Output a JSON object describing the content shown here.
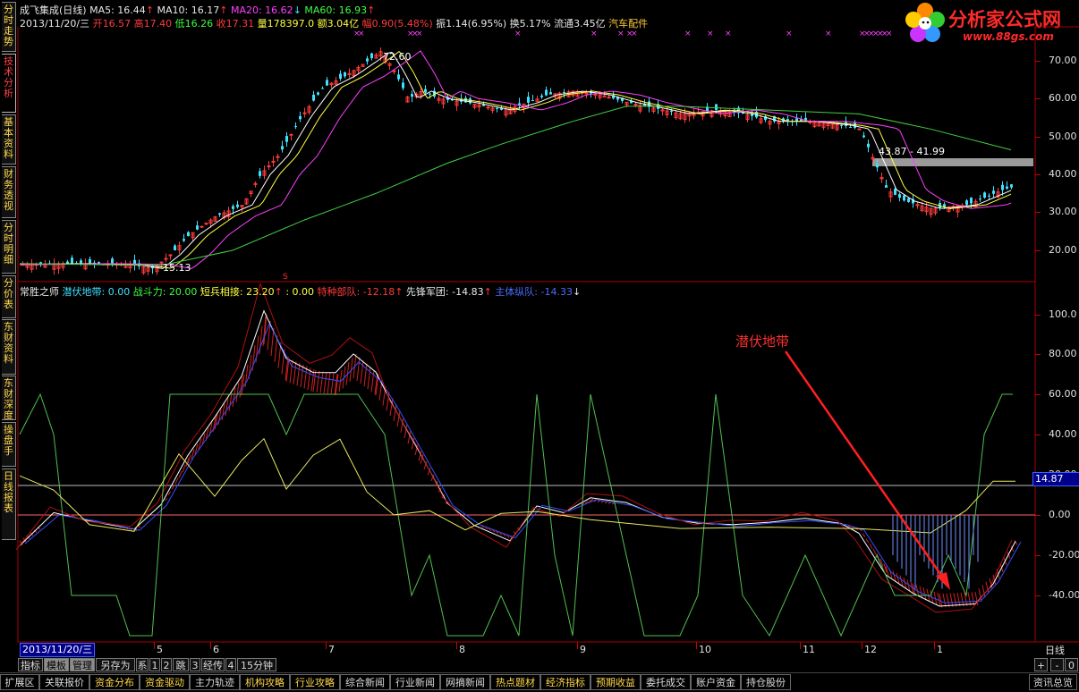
{
  "left_tabs": [
    "分时走势",
    "技术分析",
    "基本资料",
    "财务透视",
    "分时明细",
    "分价表",
    "东财资料",
    "东财深度",
    "操盘手",
    "日线报表"
  ],
  "active_tab_index": 1,
  "header": {
    "stock": "成飞集成(日线)",
    "ma5": "MA5: 16.44",
    "ma10": "MA10: 16.17",
    "ma20": "MA20: 16.62",
    "ma60": "MA60: 16.93",
    "date": "2013/11/20/三",
    "open": "开16.57",
    "high": "高17.40",
    "low": "低16.26",
    "close": "收17.31",
    "volume": "量178397.0",
    "amount": "额3.04亿",
    "change": "幅0.90(5.48%)",
    "amplitude": "振1.14(6.95%)",
    "turnover": "换5.17%",
    "float": "流通3.45亿",
    "sector": "汽车配件"
  },
  "logo": {
    "title": "分析家公式网",
    "url": "www.88gs.com"
  },
  "price_axis": [
    "70.00",
    "60.00",
    "50.00",
    "40.00",
    "30.00",
    "20.00"
  ],
  "price_annotations": {
    "high": "72.60",
    "low": "15.13",
    "range": "43.87 - 41.99"
  },
  "indicator_header": {
    "name": "常胜之师",
    "t1": "潜伏地带: 0.00",
    "t2": "战斗力: 20.00",
    "t3": "短兵相接: 23.20",
    "t4": ": 0.00",
    "t5": "特种部队: -12.18",
    "t6": "先锋军团: -14.83",
    "t7": "主体纵队: -14.33"
  },
  "indicator_axis": [
    "100.0",
    "80.00",
    "60.00",
    "40.00",
    "20.00",
    "0.00",
    "-20.00",
    "-40.00"
  ],
  "current_value_label": "14.87",
  "annotation": "潜伏地带",
  "date_axis": {
    "current": "2013/11/20/三",
    "months": [
      "5",
      "6",
      "7",
      "8",
      "9",
      "10",
      "11",
      "12",
      "1"
    ],
    "period": "日线"
  },
  "toolbar1": [
    "指标",
    "模板",
    "管理",
    "另存为",
    "系",
    "1",
    "2",
    "跳",
    "3",
    "经传",
    "4",
    "15分钟"
  ],
  "toolbar1_selected": [
    1,
    2
  ],
  "toolbar1_right": [
    "+",
    "-",
    "0"
  ],
  "toolbar2": [
    "扩展区",
    "关联报价",
    "资金分布",
    "资金驱动",
    "主力轨迹",
    "机构攻略",
    "行业攻略",
    "综合新闻",
    "行业新闻",
    "网摘新闻",
    "热点题材",
    "经济指标",
    "预期收益",
    "委托成交",
    "账户资金",
    "持仓股份"
  ],
  "toolbar2_yellow": [
    2,
    3,
    5,
    6,
    10,
    11,
    12
  ],
  "toolbar2_right": "资讯总览",
  "colors": {
    "bg": "#000000",
    "up": "#ff3b3b",
    "down": "#40e0ff",
    "ma5": "#ffffff",
    "ma10": "#ffff40",
    "ma20": "#ff40ff",
    "ma60": "#40d040"
  }
}
